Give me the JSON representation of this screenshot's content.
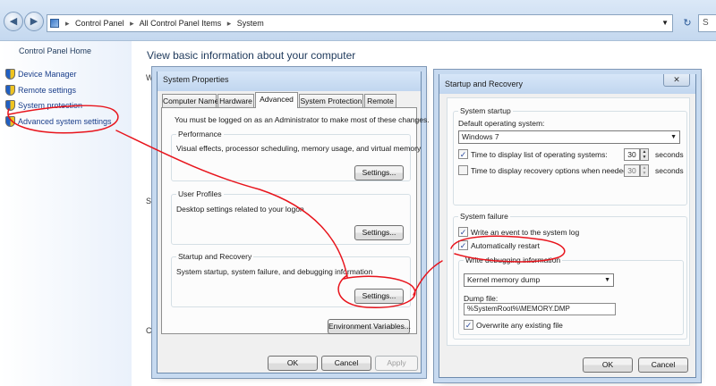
{
  "explorer": {
    "breadcrumb": [
      "Control Panel",
      "All Control Panel Items",
      "System"
    ],
    "left_pane": {
      "home": "Control Panel Home",
      "links": [
        "Device Manager",
        "Remote settings",
        "System protection",
        "Advanced system settings"
      ]
    },
    "main_title": "View basic information about your computer",
    "fragments": [
      "W",
      "S",
      "C"
    ]
  },
  "system_properties": {
    "title": "System Properties",
    "tabs": [
      "Computer Name",
      "Hardware",
      "Advanced",
      "System Protection",
      "Remote"
    ],
    "admin_note": "You must be logged on as an Administrator to make most of these changes.",
    "performance": {
      "label": "Performance",
      "desc": "Visual effects, processor scheduling, memory usage, and virtual memory",
      "button": "Settings..."
    },
    "user_profiles": {
      "label": "User Profiles",
      "desc": "Desktop settings related to your logon",
      "button": "Settings..."
    },
    "startup_recovery": {
      "label": "Startup and Recovery",
      "desc": "System startup, system failure, and debugging information",
      "button": "Settings..."
    },
    "env_button": "Environment Variables...",
    "ok": "OK",
    "cancel": "Cancel",
    "apply": "Apply"
  },
  "startup_dialog": {
    "title": "Startup and Recovery",
    "system_startup": {
      "label": "System startup",
      "default_os_label": "Default operating system:",
      "default_os_value": "Windows 7",
      "display_list_label": "Time to display list of operating systems:",
      "display_list_checked": true,
      "display_list_value": "30",
      "recovery_label": "Time to display recovery options when needed:",
      "recovery_checked": false,
      "recovery_value": "30",
      "seconds": "seconds"
    },
    "system_failure": {
      "label": "System failure",
      "write_event_label": "Write an event to the system log",
      "write_event_checked": true,
      "auto_restart_label": "Automatically restart",
      "auto_restart_checked": true,
      "debug_label": "Write debugging information",
      "debug_value": "Kernel memory dump",
      "dump_file_label": "Dump file:",
      "dump_file_value": "%SystemRoot%\\MEMORY.DMP",
      "overwrite_label": "Overwrite any existing file",
      "overwrite_checked": true
    },
    "ok": "OK",
    "cancel": "Cancel"
  },
  "colors": {
    "annotation": "#e8141c",
    "link": "#1a3e8a",
    "title_blue": "#1e395b"
  }
}
